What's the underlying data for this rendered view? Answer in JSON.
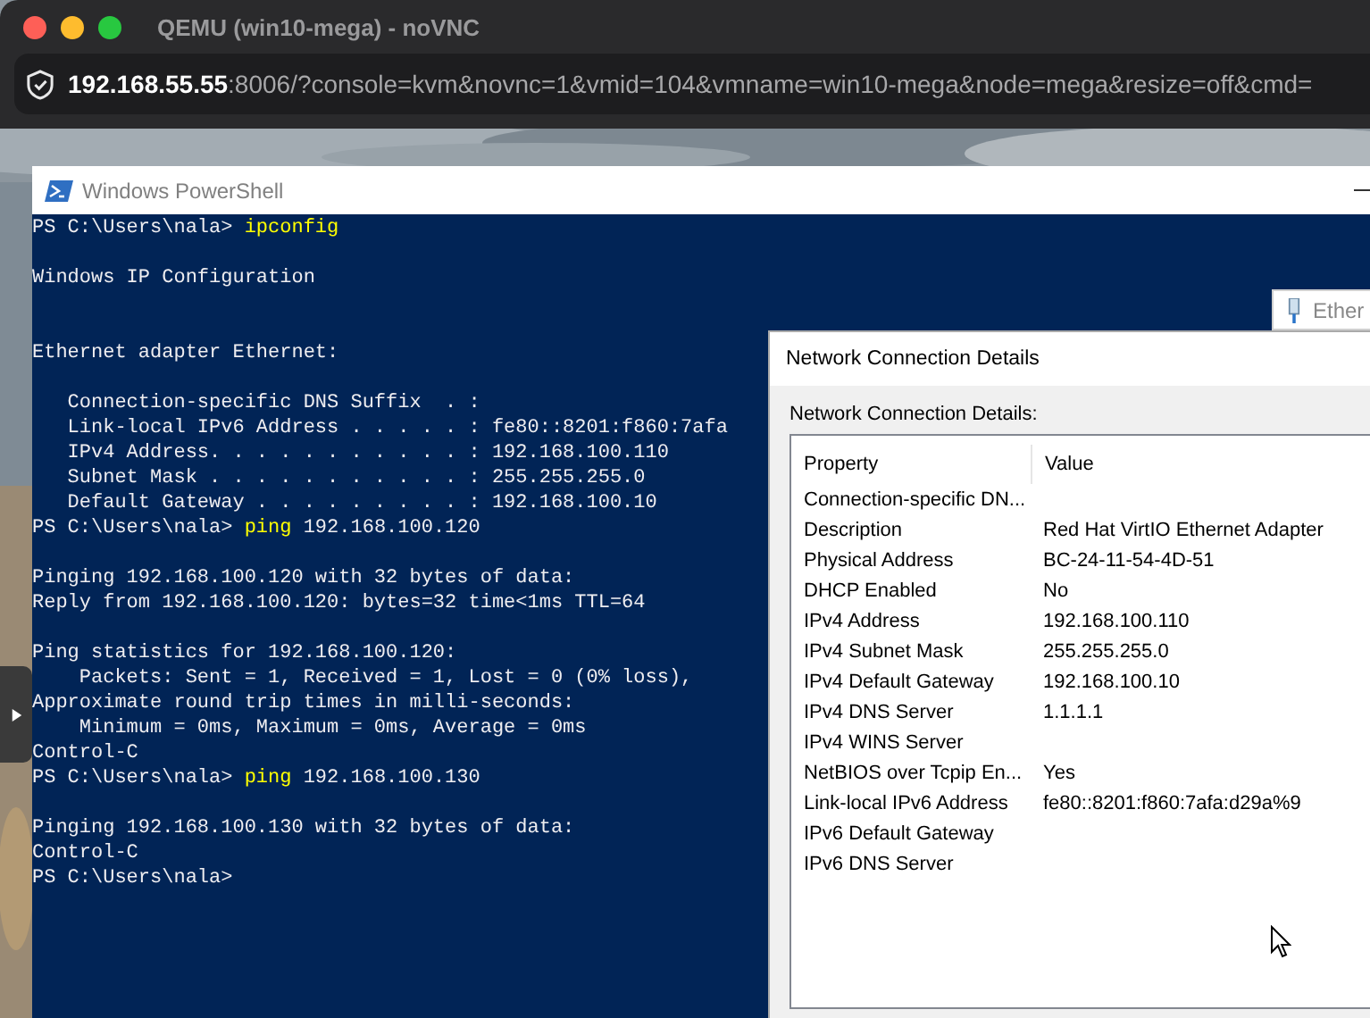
{
  "browser": {
    "title": "QEMU (win10-mega) - noVNC",
    "url_host": "192.168.55.55",
    "url_rest": ":8006/?console=kvm&novnc=1&vmid=104&vmname=win10-mega&node=mega&resize=off&cmd="
  },
  "powershell": {
    "title": "Windows PowerShell",
    "lines": [
      {
        "kind": "prompt",
        "prompt": "PS C:\\Users\\nala> ",
        "command": "ipconfig"
      },
      {
        "kind": "blank"
      },
      {
        "kind": "output",
        "text": "Windows IP Configuration"
      },
      {
        "kind": "blank"
      },
      {
        "kind": "blank"
      },
      {
        "kind": "output",
        "text": "Ethernet adapter Ethernet:"
      },
      {
        "kind": "blank"
      },
      {
        "kind": "output",
        "text": "   Connection-specific DNS Suffix  . :"
      },
      {
        "kind": "output",
        "text": "   Link-local IPv6 Address . . . . . : fe80::8201:f860:7afa"
      },
      {
        "kind": "output",
        "text": "   IPv4 Address. . . . . . . . . . . : 192.168.100.110"
      },
      {
        "kind": "output",
        "text": "   Subnet Mask . . . . . . . . . . . : 255.255.255.0"
      },
      {
        "kind": "output",
        "text": "   Default Gateway . . . . . . . . . : 192.168.100.10"
      },
      {
        "kind": "prompt",
        "prompt": "PS C:\\Users\\nala> ",
        "command": "ping",
        "args": " 192.168.100.120"
      },
      {
        "kind": "blank"
      },
      {
        "kind": "output",
        "text": "Pinging 192.168.100.120 with 32 bytes of data:"
      },
      {
        "kind": "output",
        "text": "Reply from 192.168.100.120: bytes=32 time<1ms TTL=64"
      },
      {
        "kind": "blank"
      },
      {
        "kind": "output",
        "text": "Ping statistics for 192.168.100.120:"
      },
      {
        "kind": "output",
        "text": "    Packets: Sent = 1, Received = 1, Lost = 0 (0% loss),"
      },
      {
        "kind": "output",
        "text": "Approximate round trip times in milli-seconds:"
      },
      {
        "kind": "output",
        "text": "    Minimum = 0ms, Maximum = 0ms, Average = 0ms"
      },
      {
        "kind": "output",
        "text": "Control-C"
      },
      {
        "kind": "prompt",
        "prompt": "PS C:\\Users\\nala> ",
        "command": "ping",
        "args": " 192.168.100.130"
      },
      {
        "kind": "blank"
      },
      {
        "kind": "output",
        "text": "Pinging 192.168.100.130 with 32 bytes of data:"
      },
      {
        "kind": "output",
        "text": "Control-C"
      },
      {
        "kind": "prompt",
        "prompt": "PS C:\\Users\\nala>"
      }
    ]
  },
  "background_window": {
    "tab_label": "Ether"
  },
  "details_dialog": {
    "title": "Network Connection Details",
    "label": "Network Connection Details:",
    "columns": [
      "Property",
      "Value"
    ],
    "rows": [
      {
        "property": "Connection-specific DN..."
      },
      {
        "property": "Description",
        "value": "Red Hat VirtIO Ethernet Adapter"
      },
      {
        "property": "Physical Address",
        "value": "BC-24-11-54-4D-51"
      },
      {
        "property": "DHCP Enabled",
        "value": "No"
      },
      {
        "property": "IPv4 Address",
        "value": "192.168.100.110"
      },
      {
        "property": "IPv4 Subnet Mask",
        "value": "255.255.255.0"
      },
      {
        "property": "IPv4 Default Gateway",
        "value": "192.168.100.10"
      },
      {
        "property": "IPv4 DNS Server",
        "value": "1.1.1.1"
      },
      {
        "property": "IPv4 WINS Server"
      },
      {
        "property": "NetBIOS over Tcpip En...",
        "value": "Yes"
      },
      {
        "property": "Link-local IPv6 Address",
        "value": "fe80::8201:f860:7afa:d29a%9"
      },
      {
        "property": "IPv6 Default Gateway"
      },
      {
        "property": "IPv6 DNS Server"
      }
    ]
  }
}
